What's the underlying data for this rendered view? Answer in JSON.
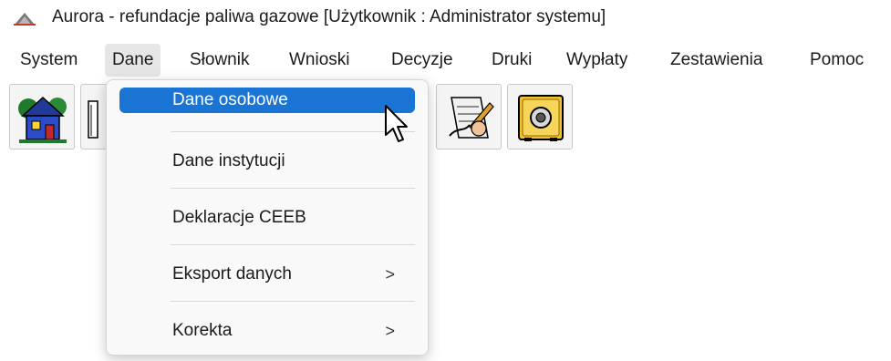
{
  "window": {
    "title": "Aurora - refundacje paliwa gazowe  [Użytkownik : Administrator systemu]",
    "app_icon": "aurora-logo-icon"
  },
  "menubar": {
    "items": [
      {
        "label": "System"
      },
      {
        "label": "Dane"
      },
      {
        "label": "Słownik"
      },
      {
        "label": "Wnioski"
      },
      {
        "label": "Decyzje"
      },
      {
        "label": "Druki"
      },
      {
        "label": "Wypłaty"
      },
      {
        "label": "Zestawienia"
      },
      {
        "label": "Pomoc"
      }
    ],
    "active": "Dane"
  },
  "toolbar": {
    "buttons": [
      {
        "icon": "house-icon"
      },
      {
        "icon": "document-icon"
      },
      {
        "icon": "signing-document-icon"
      },
      {
        "icon": "safe-icon"
      }
    ]
  },
  "dropdown": {
    "items": [
      {
        "label": "Dane osobowe",
        "submenu": false,
        "highlighted": true
      },
      {
        "label": "Dane instytucji",
        "submenu": false
      },
      {
        "label": "Deklaracje CEEB",
        "submenu": false
      },
      {
        "label": "Eksport danych",
        "submenu": true,
        "arrow": ">"
      },
      {
        "label": "Korekta",
        "submenu": true,
        "arrow": ">"
      }
    ]
  },
  "colors": {
    "highlight": "#1a74d4",
    "menu_bg": "#f9f9f9",
    "active_menu_bg": "#e6e6e6"
  }
}
